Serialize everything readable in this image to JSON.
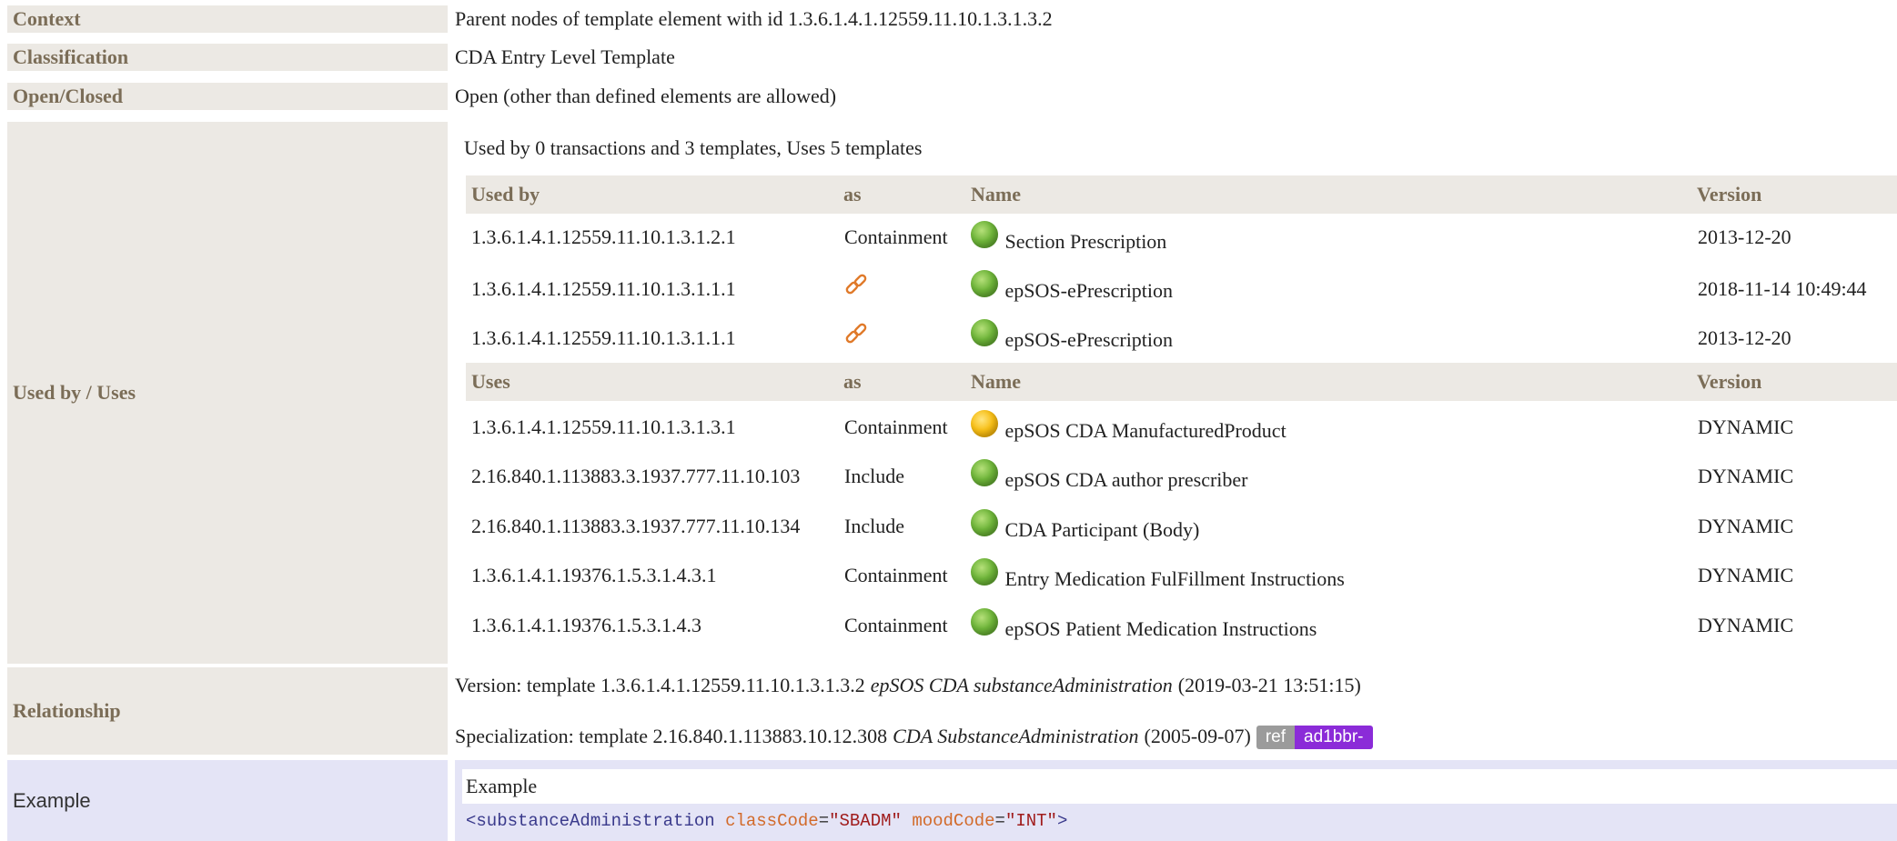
{
  "context": {
    "label": "Context",
    "value": "Parent nodes of template element with id 1.3.6.1.4.1.12559.11.10.1.3.1.3.2"
  },
  "classification": {
    "label": "Classification",
    "value": "CDA Entry Level Template"
  },
  "open_closed": {
    "label": "Open/Closed",
    "value": "Open (other than defined elements are allowed)"
  },
  "used_by_uses": {
    "label": "Used by / Uses",
    "summary": "Used by 0 transactions and 3 templates, Uses 5 templates",
    "used_by_header": {
      "col1": "Used by",
      "col2": "as",
      "col3": "Name",
      "col4": "Version"
    },
    "used_by_rows": [
      {
        "id": "1.3.6.1.4.1.12559.11.10.1.3.1.2.1",
        "as": "Containment",
        "as_icon": "",
        "status": "green",
        "name": "Section Prescription",
        "version": "2013-12-20"
      },
      {
        "id": "1.3.6.1.4.1.12559.11.10.1.3.1.1.1",
        "as": "",
        "as_icon": "link-icon",
        "status": "green",
        "name": "epSOS-ePrescription",
        "version": "2018-11-14 10:49:44"
      },
      {
        "id": "1.3.6.1.4.1.12559.11.10.1.3.1.1.1",
        "as": "",
        "as_icon": "link-icon",
        "status": "green",
        "name": "epSOS-ePrescription",
        "version": "2013-12-20"
      }
    ],
    "uses_header": {
      "col1": "Uses",
      "col2": "as",
      "col3": "Name",
      "col4": "Version"
    },
    "uses_rows": [
      {
        "id": "1.3.6.1.4.1.12559.11.10.1.3.1.3.1",
        "as": "Containment",
        "status": "yellow",
        "name": "epSOS CDA ManufacturedProduct",
        "version": "DYNAMIC"
      },
      {
        "id": "2.16.840.1.113883.3.1937.777.11.10.103",
        "as": "Include",
        "status": "green",
        "name": "epSOS CDA author prescriber",
        "version": "DYNAMIC"
      },
      {
        "id": "2.16.840.1.113883.3.1937.777.11.10.134",
        "as": "Include",
        "status": "green",
        "name": "CDA Participant (Body)",
        "version": "DYNAMIC"
      },
      {
        "id": "1.3.6.1.4.1.19376.1.5.3.1.4.3.1",
        "as": "Containment",
        "status": "green",
        "name": "Entry Medication FulFillment Instructions",
        "version": "DYNAMIC"
      },
      {
        "id": "1.3.6.1.4.1.19376.1.5.3.1.4.3",
        "as": "Containment",
        "status": "green",
        "name": "epSOS Patient Medication Instructions",
        "version": "DYNAMIC"
      }
    ]
  },
  "relationship": {
    "label": "Relationship",
    "version_prefix": "Version: template 1.3.6.1.4.1.12559.11.10.1.3.1.3.2",
    "version_name": "epSOS CDA substanceAdministration",
    "version_date": "(2019-03-21 13:51:15)",
    "specialization_prefix": "Specialization: template 2.16.840.1.113883.10.12.308",
    "specialization_name": "CDA SubstanceAdministration",
    "specialization_date": "(2005-09-07)",
    "badge_ref": "ref",
    "badge_prefix": "ad1bbr-"
  },
  "example": {
    "label": "Example",
    "title": "Example",
    "code": {
      "open": "<",
      "tag": "substanceAdministration",
      "attr1": "classCode",
      "eq1": "=",
      "val1": "\"SBADM\"",
      "attr2": "moodCode",
      "eq2": "=",
      "val2": "\"INT\"",
      "close": ">"
    }
  },
  "colors": {
    "label_bg": "#ece9e4",
    "label_text": "#7b6d57",
    "example_bg": "#e4e4f6",
    "status_green": "#6fb53a",
    "status_yellow": "#f7bf17",
    "badge_ref": "#9b9b9b",
    "badge_prefix": "#8b2bd8",
    "link_icon": "#e07a2a"
  }
}
